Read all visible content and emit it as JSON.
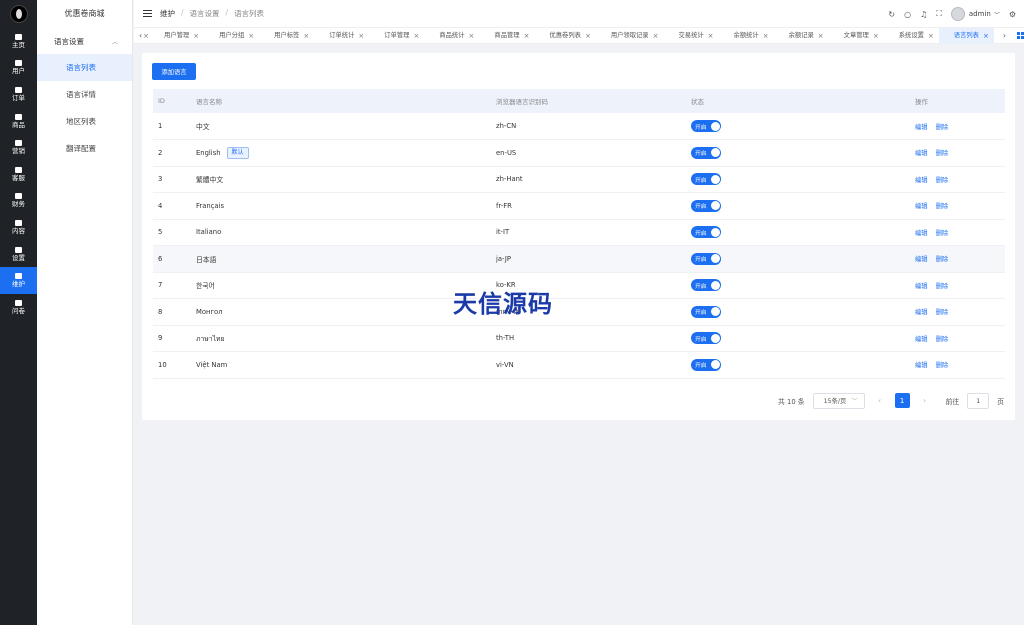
{
  "rail": {
    "items": [
      {
        "label": "主页",
        "icon": "home-icon"
      },
      {
        "label": "用户",
        "icon": "user-icon"
      },
      {
        "label": "订单",
        "icon": "order-icon"
      },
      {
        "label": "商品",
        "icon": "goods-icon"
      },
      {
        "label": "营销",
        "icon": "marketing-icon"
      },
      {
        "label": "客服",
        "icon": "service-icon"
      },
      {
        "label": "财务",
        "icon": "finance-icon"
      },
      {
        "label": "内容",
        "icon": "content-icon"
      },
      {
        "label": "设置",
        "icon": "settings-icon"
      },
      {
        "label": "维护",
        "icon": "maintain-icon",
        "active": true
      },
      {
        "label": "问卷",
        "icon": "survey-icon"
      }
    ]
  },
  "submenu": {
    "app_title": "优惠卷商城",
    "group_label": "语言设置",
    "items": [
      "语言列表",
      "语言详情",
      "地区列表",
      "翻译配置"
    ]
  },
  "header": {
    "breadcrumb": [
      "维护",
      "语言设置",
      "语言列表"
    ],
    "user_name": "admin"
  },
  "tabs": [
    "用户管理",
    "用户分组",
    "用户标签",
    "订单统计",
    "订单管理",
    "商品统计",
    "商品管理",
    "优惠卷列表",
    "用户领取记录",
    "交易统计",
    "余额统计",
    "余额记录",
    "文章管理",
    "系统设置",
    "语言列表"
  ],
  "accent_color": "#1d6ff2",
  "main": {
    "add_button": "添加语言",
    "columns": {
      "id": "ID",
      "name": "语言名称",
      "code": "浏览器语言识别码",
      "status": "状态",
      "ops": "操作"
    },
    "default_tag": "默认",
    "switch_on": "开启",
    "op_edit": "编辑",
    "op_delete": "删除",
    "rows": [
      {
        "id": "1",
        "name": "中文",
        "code": "zh-CN"
      },
      {
        "id": "2",
        "name": "English",
        "code": "en-US",
        "default": true
      },
      {
        "id": "3",
        "name": "繁體中文",
        "code": "zh-Hant"
      },
      {
        "id": "4",
        "name": "Français",
        "code": "fr-FR"
      },
      {
        "id": "5",
        "name": "Italiano",
        "code": "it-IT"
      },
      {
        "id": "6",
        "name": "日本語",
        "code": "ja-JP"
      },
      {
        "id": "7",
        "name": "한국어",
        "code": "ko-KR"
      },
      {
        "id": "8",
        "name": "Монгол",
        "code": "mn-MN"
      },
      {
        "id": "9",
        "name": "ภาษาไทย",
        "code": "th-TH"
      },
      {
        "id": "10",
        "name": "Việt Nam",
        "code": "vi-VN"
      }
    ]
  },
  "pagination": {
    "total_text": "共 10 条",
    "page_size": "15条/页",
    "current_page": "1",
    "goto_label": "前往",
    "goto_value": "1",
    "page_suffix": "页"
  },
  "watermark": "天信源码"
}
